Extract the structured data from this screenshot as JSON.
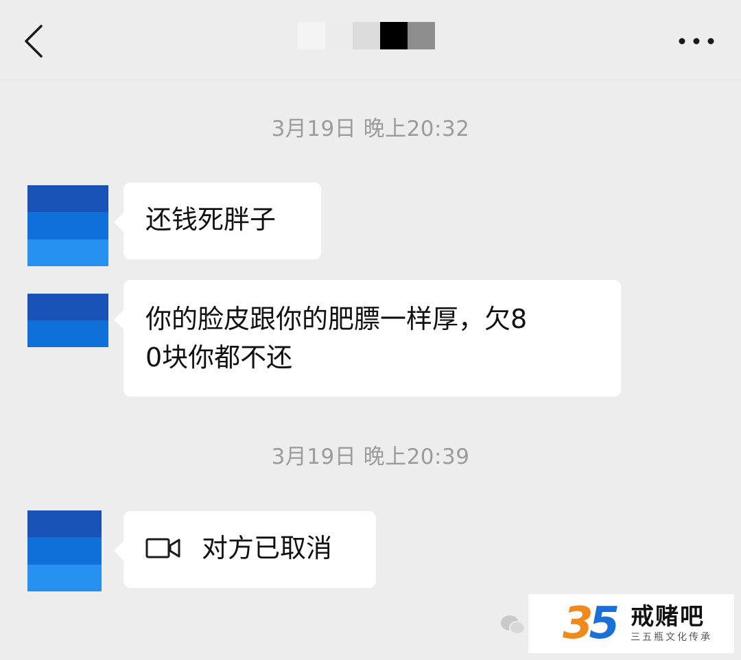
{
  "header": {
    "back_icon": "chevron-left-icon",
    "more_icon": "more-dots-icon",
    "title_masked_colors": [
      "#f4f4f4",
      "#ececec",
      "#e2e2e2",
      "#d6d6d6",
      "#bdbdbd",
      "#000000",
      "#1f1f1f",
      "#8d8d8d"
    ]
  },
  "messages": [
    {
      "type": "timestamp",
      "text": "3月19日 晚上20:32"
    },
    {
      "type": "text",
      "sender": "other",
      "text": "还钱死胖子"
    },
    {
      "type": "text",
      "sender": "other",
      "lines": [
        "你的脸皮跟你的肥膘一样厚，欠8",
        "0块你都不还"
      ]
    },
    {
      "type": "timestamp",
      "text": "3月19日 晚上20:39"
    },
    {
      "type": "video_call",
      "sender": "other",
      "icon": "video-camera-icon",
      "text": "对方已取消"
    }
  ],
  "avatar_colors": [
    "#1a53b8",
    "#0e70d8",
    "#2590ef"
  ],
  "watermark": {
    "icon": "wechat-icon",
    "logo_digits": "35",
    "logo_colors": {
      "three": "#f08a1c",
      "five": "#1b6fd8"
    },
    "brand_name": "戒赌吧",
    "brand_sub": "三五瓶文化传承"
  }
}
